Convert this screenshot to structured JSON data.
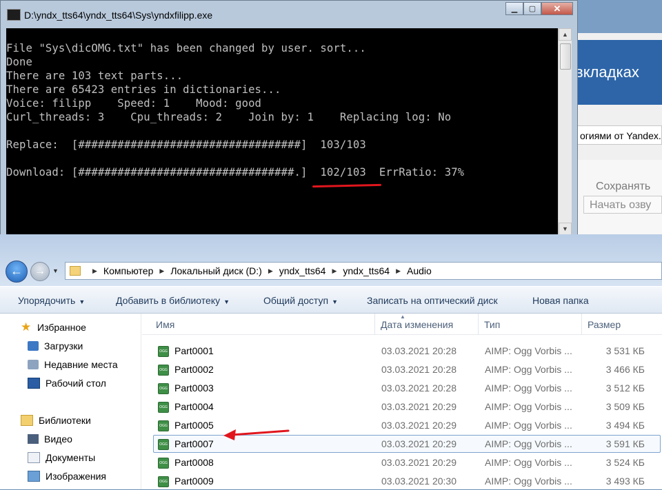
{
  "background_app": {
    "header_text": "вкладках",
    "yandex_text": "огиями от Yandex.",
    "save_button": "Сохранять",
    "start_button": "Начать озву"
  },
  "console": {
    "title": "D:\\yndx_tts64\\yndx_tts64\\Sys\\yndxfilipp.exe",
    "lines": [
      "File \"Sys\\dicOMG.txt\" has been changed by user. sort...",
      "Done",
      "There are 103 text parts...",
      "There are 65423 entries in dictionaries...",
      "Voice: filipp    Speed: 1    Mood: good",
      "Curl_threads: 3    Cpu_threads: 2    Join by: 1    Replacing log: No",
      "",
      "Replace:  [##################################]  103/103",
      "",
      "Download: [#################################.]  102/103  ErrRatio: 37%"
    ]
  },
  "explorer": {
    "breadcrumb": [
      "Компьютер",
      "Локальный диск (D:)",
      "yndx_tts64",
      "yndx_tts64",
      "Audio"
    ],
    "toolbar": {
      "organize": "Упорядочить",
      "add_library": "Добавить в библиотеку",
      "share": "Общий доступ",
      "burn": "Записать на оптический диск",
      "new_folder": "Новая папка"
    },
    "nav": {
      "favorites": "Избранное",
      "downloads": "Загрузки",
      "recent": "Недавние места",
      "desktop": "Рабочий стол",
      "libraries": "Библиотеки",
      "video": "Видео",
      "documents": "Документы",
      "images": "Изображения"
    },
    "columns": {
      "name": "Имя",
      "date": "Дата изменения",
      "type": "Тип",
      "size": "Размер"
    },
    "icon_label": "OGG",
    "files": [
      {
        "name": "Part0001",
        "date": "03.03.2021 20:28",
        "type": "AIMP: Ogg Vorbis ...",
        "size": "3 531 КБ"
      },
      {
        "name": "Part0002",
        "date": "03.03.2021 20:28",
        "type": "AIMP: Ogg Vorbis ...",
        "size": "3 466 КБ"
      },
      {
        "name": "Part0003",
        "date": "03.03.2021 20:28",
        "type": "AIMP: Ogg Vorbis ...",
        "size": "3 512 КБ"
      },
      {
        "name": "Part0004",
        "date": "03.03.2021 20:29",
        "type": "AIMP: Ogg Vorbis ...",
        "size": "3 509 КБ"
      },
      {
        "name": "Part0005",
        "date": "03.03.2021 20:29",
        "type": "AIMP: Ogg Vorbis ...",
        "size": "3 494 КБ"
      },
      {
        "name": "Part0007",
        "date": "03.03.2021 20:29",
        "type": "AIMP: Ogg Vorbis ...",
        "size": "3 591 КБ"
      },
      {
        "name": "Part0008",
        "date": "03.03.2021 20:29",
        "type": "AIMP: Ogg Vorbis ...",
        "size": "3 524 КБ"
      },
      {
        "name": "Part0009",
        "date": "03.03.2021 20:30",
        "type": "AIMP: Ogg Vorbis ...",
        "size": "3 493 КБ"
      }
    ]
  },
  "colors": {
    "annotation_red": "#e1161d",
    "console_bg": "#000000",
    "console_text": "#c0c0c0"
  }
}
